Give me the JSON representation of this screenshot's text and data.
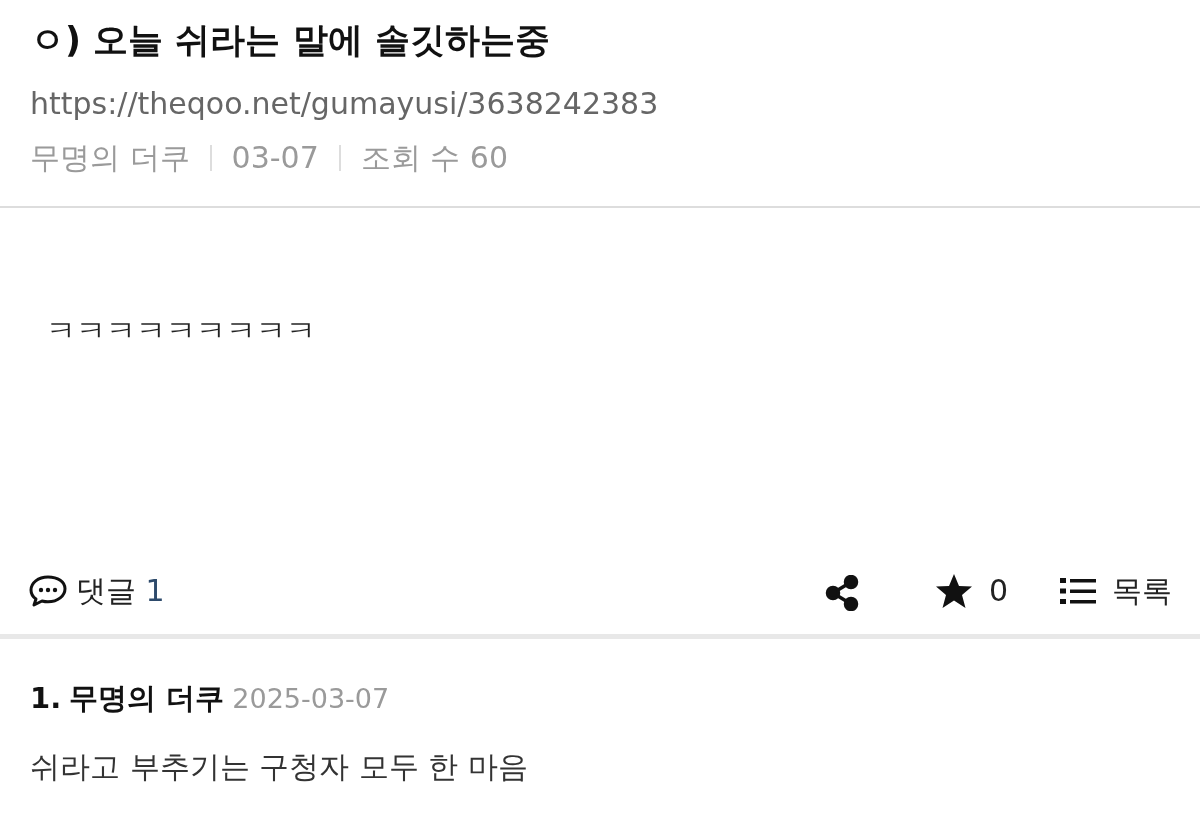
{
  "post": {
    "title": "ㅇ) 오늘 쉬라는 말에 솔깃하는중",
    "url": "https://theqoo.net/gumayusi/3638242383",
    "meta": [
      "무명의 더쿠",
      "03-07",
      "조회 수 60"
    ],
    "body": "ㅋㅋㅋㅋㅋㅋㅋㅋㅋ"
  },
  "actions": {
    "comments_label": "댓글",
    "comments_count": "1",
    "likes": "0",
    "list_label": "목록"
  },
  "comments": [
    {
      "number": "1.",
      "author": "무명의 더쿠",
      "date": "2025-03-07",
      "text": "쉬라고 부추기는 구청자 모두 한 마음"
    }
  ]
}
